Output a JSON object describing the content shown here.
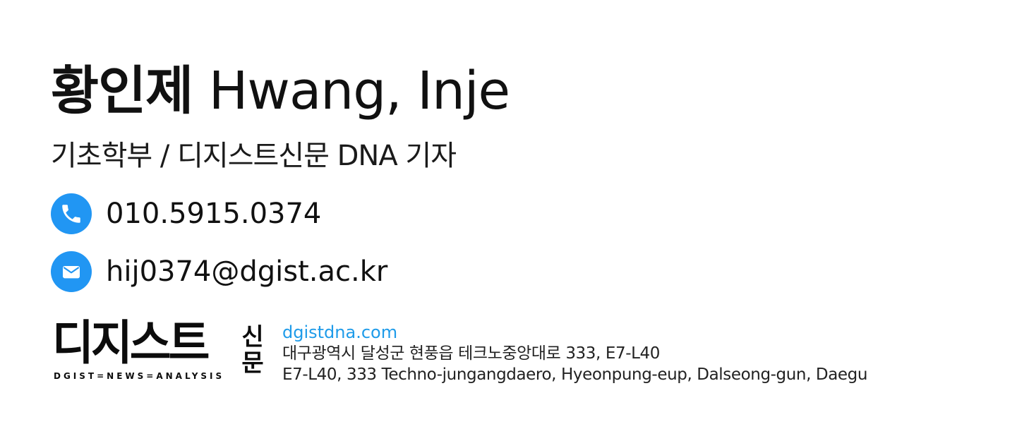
{
  "name": {
    "korean": "황인제",
    "english": "Hwang, Inje"
  },
  "role": "기초학부 / 디지스트신문 DNA 기자",
  "contacts": {
    "phone": {
      "icon": "phone-icon",
      "value": "010.5915.0374"
    },
    "email": {
      "icon": "mail-icon",
      "value": "hij0374@dgist.ac.kr"
    }
  },
  "logo": {
    "main": "디지스트",
    "side": "신문",
    "tagline": "DGIST=NEWS=ANALYSIS"
  },
  "org": {
    "url": "dgistdna.com",
    "address_ko": "대구광역시 달성군 현풍읍 테크노중앙대로 333, E7-L40",
    "address_en": "E7-L40, 333 Techno-jungangdaero, Hyeonpung-eup, Dalseong-gun, Daegu"
  },
  "colors": {
    "accent": "#2196f3",
    "link": "#1e9be9",
    "text": "#111111"
  }
}
